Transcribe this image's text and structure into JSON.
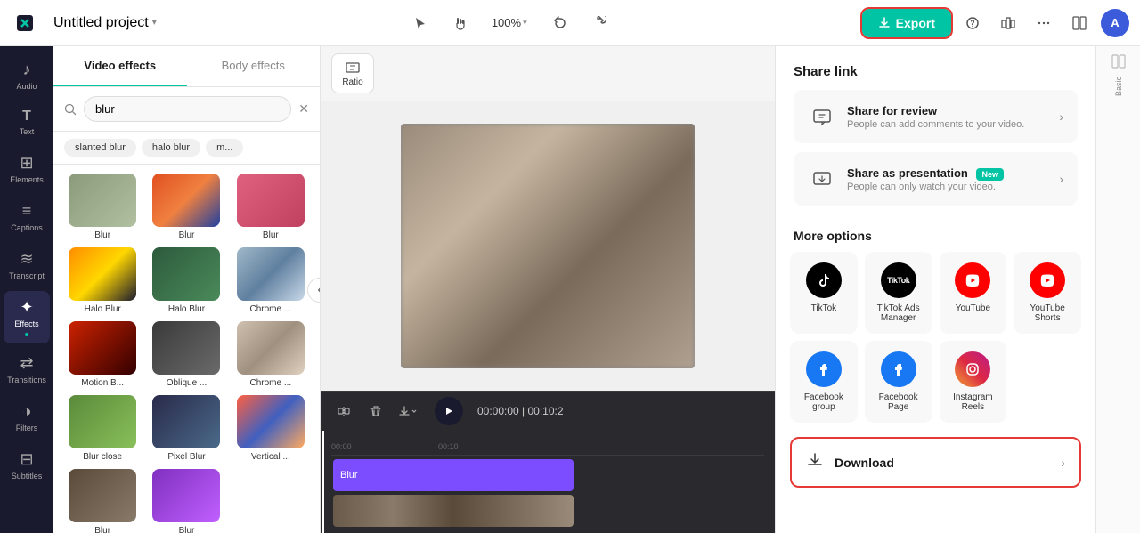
{
  "topbar": {
    "logo": "✂",
    "project_name": "Untitled project",
    "zoom": "100%",
    "export_label": "Export",
    "avatar_initials": "A"
  },
  "sidebar": {
    "items": [
      {
        "id": "audio",
        "label": "Audio",
        "icon": "♪"
      },
      {
        "id": "text",
        "label": "Text",
        "icon": "T"
      },
      {
        "id": "elements",
        "label": "Elements",
        "icon": "⊞"
      },
      {
        "id": "captions",
        "label": "Captions",
        "icon": "≡"
      },
      {
        "id": "transcript",
        "label": "Transcript",
        "icon": "≋"
      },
      {
        "id": "effects",
        "label": "Effects",
        "icon": "★"
      },
      {
        "id": "transitions",
        "label": "Transitions",
        "icon": "⇄"
      },
      {
        "id": "filters",
        "label": "Filters",
        "icon": "◑"
      },
      {
        "id": "subtitles",
        "label": "Subtitles",
        "icon": "⊟"
      }
    ]
  },
  "effects_panel": {
    "tab_video": "Video effects",
    "tab_body": "Body effects",
    "search_placeholder": "blur",
    "search_value": "blur",
    "filter_tags": [
      "slanted blur",
      "halo blur",
      "m..."
    ],
    "effects": [
      {
        "id": "blur1",
        "label": "Blur",
        "thumb": "thumb-blur1"
      },
      {
        "id": "blur2",
        "label": "Blur",
        "thumb": "thumb-blur2"
      },
      {
        "id": "blur3",
        "label": "Blur",
        "thumb": "thumb-blur3"
      },
      {
        "id": "halo1",
        "label": "Halo Blur",
        "thumb": "thumb-halo1"
      },
      {
        "id": "halo2",
        "label": "Halo Blur",
        "thumb": "thumb-halo2"
      },
      {
        "id": "chrome1",
        "label": "Chrome ...",
        "thumb": "thumb-chrome1"
      },
      {
        "id": "motionb",
        "label": "Motion B...",
        "thumb": "thumb-motionb"
      },
      {
        "id": "oblique",
        "label": "Oblique ...",
        "thumb": "thumb-oblique"
      },
      {
        "id": "chrome2",
        "label": "Chrome ...",
        "thumb": "thumb-chrome2"
      },
      {
        "id": "blurclose",
        "label": "Blur close",
        "thumb": "thumb-blurclose"
      },
      {
        "id": "pixelblur",
        "label": "Pixel Blur",
        "thumb": "thumb-pixelblur"
      },
      {
        "id": "vertical",
        "label": "Vertical ...",
        "thumb": "thumb-vertical"
      },
      {
        "id": "extra1",
        "label": "Blur",
        "thumb": "thumb-extra1"
      },
      {
        "id": "extra2",
        "label": "Blur",
        "thumb": "thumb-extra2"
      }
    ]
  },
  "canvas": {
    "ratio_label": "Ratio",
    "time_current": "00:00:00",
    "time_total": "00:10:2"
  },
  "right_panel": {
    "share_link_title": "Share link",
    "share_review_title": "Share for review",
    "share_review_subtitle": "People can add comments to your video.",
    "share_presentation_title": "Share as presentation",
    "share_presentation_subtitle": "People can only watch your video.",
    "share_presentation_badge": "New",
    "more_options_title": "More options",
    "platforms": [
      {
        "id": "tiktok",
        "label": "TikTok",
        "icon_class": "tiktok-icon",
        "icon": "♪"
      },
      {
        "id": "tiktok-ads",
        "label": "TikTok Ads Manager",
        "icon_class": "tiktok-ads-icon",
        "icon": "▶"
      },
      {
        "id": "youtube",
        "label": "YouTube",
        "icon_class": "youtube-icon",
        "icon": "▶"
      },
      {
        "id": "youtube-shorts",
        "label": "YouTube Shorts",
        "icon_class": "youtube-shorts-icon",
        "icon": "▶"
      },
      {
        "id": "fb-group",
        "label": "Facebook group",
        "icon_class": "fb-group-icon",
        "icon": "f"
      },
      {
        "id": "fb-page",
        "label": "Facebook Page",
        "icon_class": "fb-page-icon",
        "icon": "f"
      },
      {
        "id": "instagram",
        "label": "Instagram Reels",
        "icon_class": "instagram-icon",
        "icon": "◎"
      }
    ],
    "download_label": "Download"
  },
  "basic_panel": {
    "label": "Basic"
  },
  "timeline": {
    "blur_track_label": "Blur",
    "time_display": "00:00:00 | 00:10:2"
  }
}
